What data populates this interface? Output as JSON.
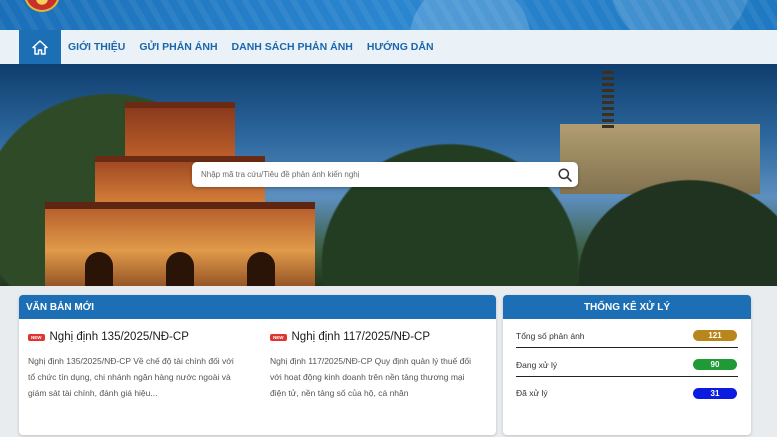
{
  "nav": {
    "items": [
      "GIỚI THIỆU",
      "GỬI PHẢN ÁNH",
      "DANH SÁCH PHẢN ÁNH",
      "HƯỚNG DẪN"
    ]
  },
  "search": {
    "placeholder": "Nhập mã tra cứu/Tiêu đề phản ánh kiến nghị"
  },
  "documents": {
    "heading": "VĂN BẢN MỚI",
    "badge": "NEW",
    "items": [
      {
        "title": "Nghị định 135/2025/NĐ-CP",
        "summary": "Nghị định 135/2025/NĐ-CP Về chế độ tài chính đối với tổ chức tín dụng, chi nhánh ngân hàng nước ngoài và giám sát tài chính, đánh giá hiệu..."
      },
      {
        "title": "Nghị định 117/2025/NĐ-CP",
        "summary": "Nghị định 117/2025/NĐ-CP Quy định quản lý thuế đối với hoạt động kinh doanh trên nền tảng thương mại điện tử, nền tảng số của hộ, cá nhân"
      }
    ]
  },
  "stats": {
    "heading": "THỐNG KÊ XỬ LÝ",
    "rows": [
      {
        "label": "Tổng số phản ánh",
        "value": "121",
        "color": "#b8861b"
      },
      {
        "label": "Đang xử lý",
        "value": "90",
        "color": "#1f9a36"
      },
      {
        "label": "Đã xử lý",
        "value": "31",
        "color": "#0b1be0"
      }
    ]
  },
  "colors": {
    "primary": "#1c6fb4",
    "nav_text": "#1a67ad",
    "badge_new": "#e0342e"
  }
}
